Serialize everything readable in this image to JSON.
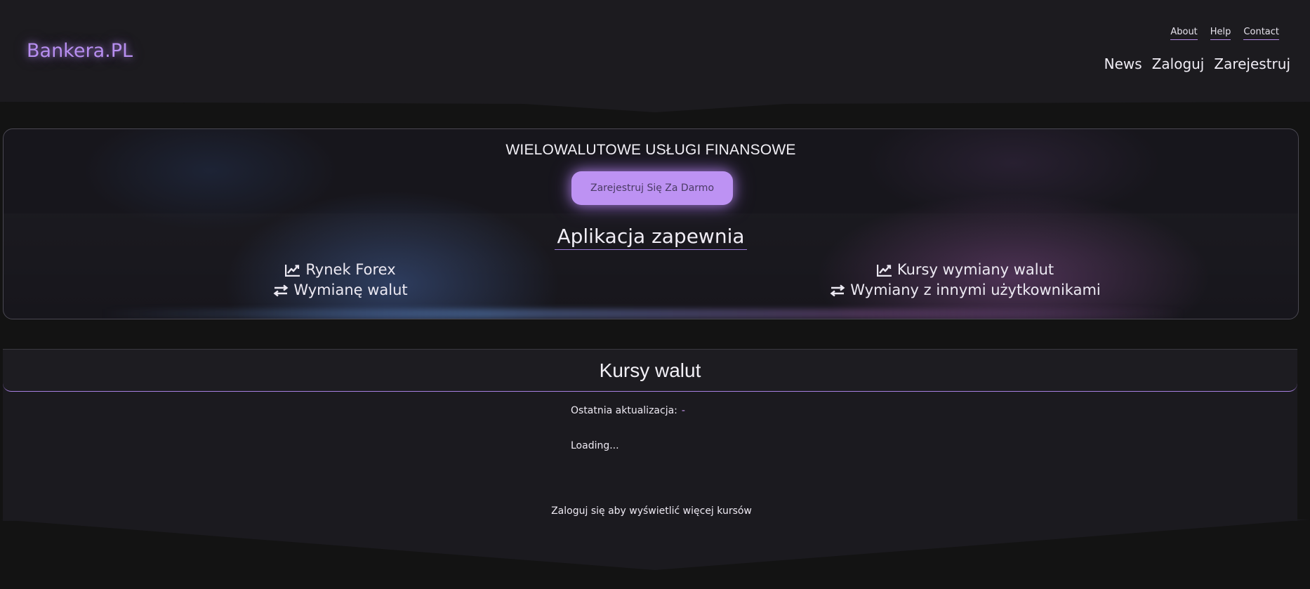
{
  "header": {
    "logo": "Bankera.PL",
    "top_links": [
      "About",
      "Help",
      "Contact"
    ],
    "nav": [
      "News",
      "Zaloguj",
      "Zarejestruj"
    ]
  },
  "hero": {
    "title": "WIELOWALUTOWE USŁUGI FINANSOWE",
    "cta_label": "Zarejestruj Się Za Darmo",
    "features_heading": "Aplikacja zapewnia",
    "features_left": [
      {
        "icon": "chart-line-icon",
        "label": "Rynek Forex"
      },
      {
        "icon": "exchange-arrows-icon",
        "label": "Wymianę walut"
      }
    ],
    "features_right": [
      {
        "icon": "chart-line-icon",
        "label": "Kursy wymiany walut"
      },
      {
        "icon": "exchange-arrows-icon",
        "label": "Wymiany z innymi użytkownikami"
      }
    ]
  },
  "rates": {
    "title": "Kursy walut",
    "last_update_label": "Ostatnia aktualizacja:",
    "last_update_value": "-",
    "loading_text": "Loading...",
    "login_note": "Zaloguj się aby wyświetlić więcej kursów"
  },
  "colors": {
    "background": "#131313",
    "panel": "#1c1b1f",
    "accent": "#bd92f3",
    "logo": "#b78ef0"
  }
}
